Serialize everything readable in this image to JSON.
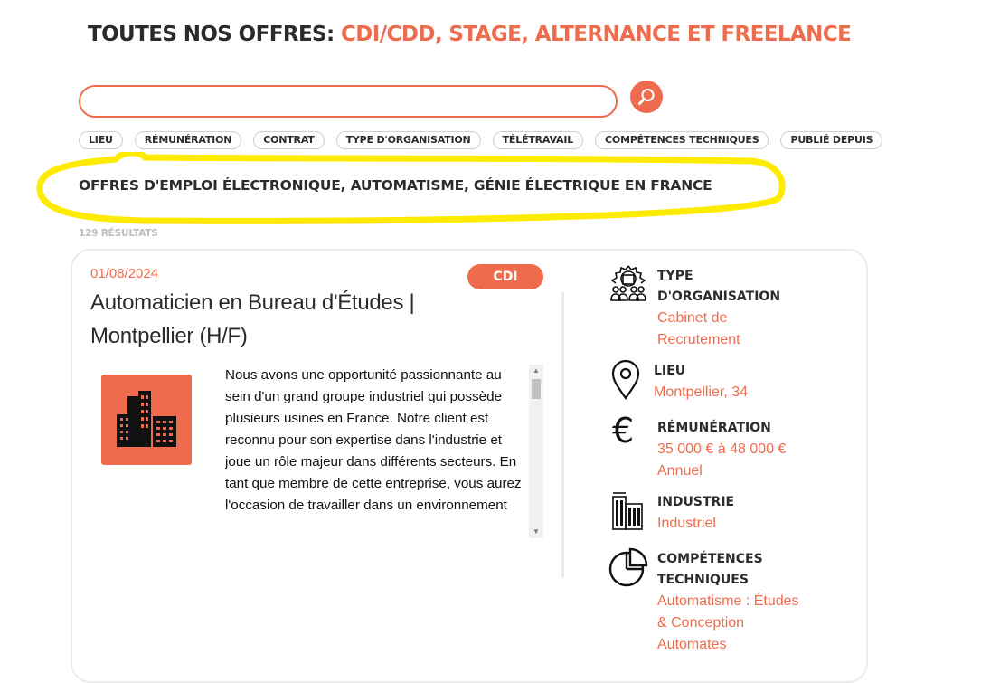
{
  "header": {
    "title_dark": "TOUTES NOS OFFRES: ",
    "title_accent": "CDI/CDD, STAGE, ALTERNANCE ET FREELANCE"
  },
  "search": {
    "value": "",
    "placeholder": ""
  },
  "filters": [
    "LIEU",
    "RÉMUNÉRATION",
    "CONTRAT",
    "TYPE D'ORGANISATION",
    "TÉLÉTRAVAIL",
    "COMPÉTENCES TECHNIQUES",
    "PUBLIÉ DEPUIS"
  ],
  "results": {
    "heading": "OFFRES D'EMPLOI ÉLECTRONIQUE, AUTOMATISME, GÉNIE ÉLECTRIQUE EN FRANCE",
    "count": "129 RÉSULTATS"
  },
  "job": {
    "date": "01/08/2024",
    "contract": "CDI",
    "title_line1": "Automaticien en Bureau d'Études |",
    "title_line2": "Montpellier (H/F)",
    "description": "Nous avons une opportunité passionnante au sein d'un grand groupe industriel qui possède plusieurs usines en France. Notre client est reconnu pour son expertise dans l'industrie et joue un rôle majeur dans différents secteurs. En tant que membre de cette entreprise, vous aurez l'occasion de travailler dans un environnement",
    "details": {
      "org_label_1": "TYPE",
      "org_label_2": "D'ORGANISATION",
      "org_value_1": "Cabinet de",
      "org_value_2": "Recrutement",
      "lieu_label": "LIEU",
      "lieu_value": "Montpellier, 34",
      "remu_label": "RÉMUNÉRATION",
      "remu_value_1": "35 000 € à 48 000 €",
      "remu_value_2": "Annuel",
      "industrie_label": "INDUSTRIE",
      "industrie_value": "Industriel",
      "comp_label_1": "COMPÉTENCES",
      "comp_label_2": "TECHNIQUES",
      "comp_value_1": "Automatisme : Études",
      "comp_value_2": "& Conception",
      "comp_value_3": "Automates"
    }
  },
  "colors": {
    "accent": "#ee6c4d",
    "highlight": "#ffeb00"
  }
}
